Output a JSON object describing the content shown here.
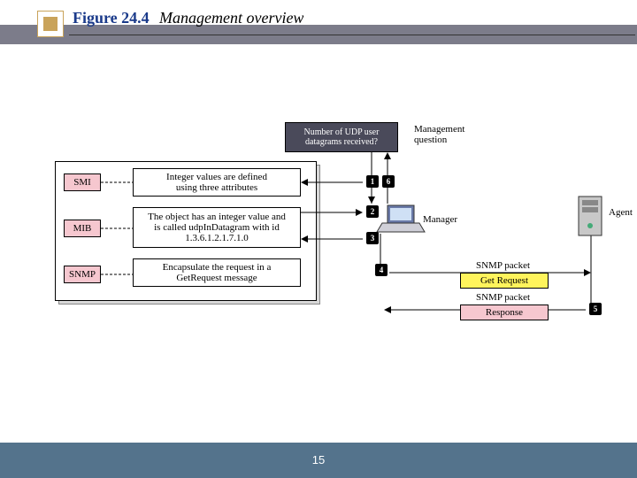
{
  "figure": {
    "number": "Figure 24.4",
    "title": "Management overview"
  },
  "question_box": "Number of UDP user\ndatagrams received?",
  "question_label": "Management\nquestion",
  "defs": {
    "smi": {
      "tag": "SMI",
      "text": "Integer values are defined\nusing three attributes"
    },
    "mib": {
      "tag": "MIB",
      "text": "The object has an integer value and\nis called udpInDatagram with id\n1.3.6.1.2.1.7.1.0"
    },
    "snmp": {
      "tag": "SNMP",
      "text": "Encapsulate the request in a\nGetRequest message"
    }
  },
  "roles": {
    "manager": "Manager",
    "agent": "Agent"
  },
  "packets": {
    "req_label": "SNMP packet",
    "req": "Get Request",
    "res_label": "SNMP packet",
    "res": "Response"
  },
  "steps": {
    "s1": "1",
    "s2": "2",
    "s3": "3",
    "s4": "4",
    "s5": "5",
    "s6": "6"
  },
  "page_number": "15"
}
